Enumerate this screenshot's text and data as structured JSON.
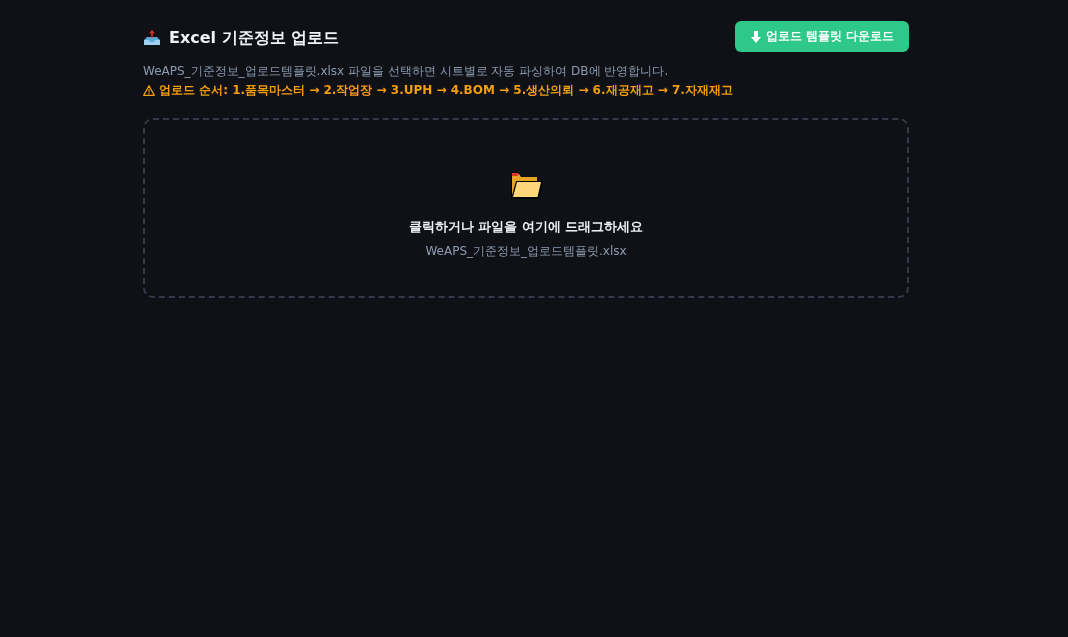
{
  "header": {
    "title": "Excel 기준정보 업로드",
    "download_button": "업로드 템플릿 다운로드"
  },
  "description": "WeAPS_기준정보_업로드템플릿.xlsx 파일을 선택하면 시트별로 자동 파싱하여 DB에 반영합니다.",
  "upload_order": "업로드 순서: 1.품목마스터 → 2.작업장 → 3.UPH → 4.BOM → 5.생산의뢰 → 6.재공재고 → 7.자재재고",
  "dropzone": {
    "prompt": "클릭하거나 파일을 여기에 드래그하세요",
    "file_name": "WeAPS_기준정보_업로드템플릿.xlsx"
  }
}
